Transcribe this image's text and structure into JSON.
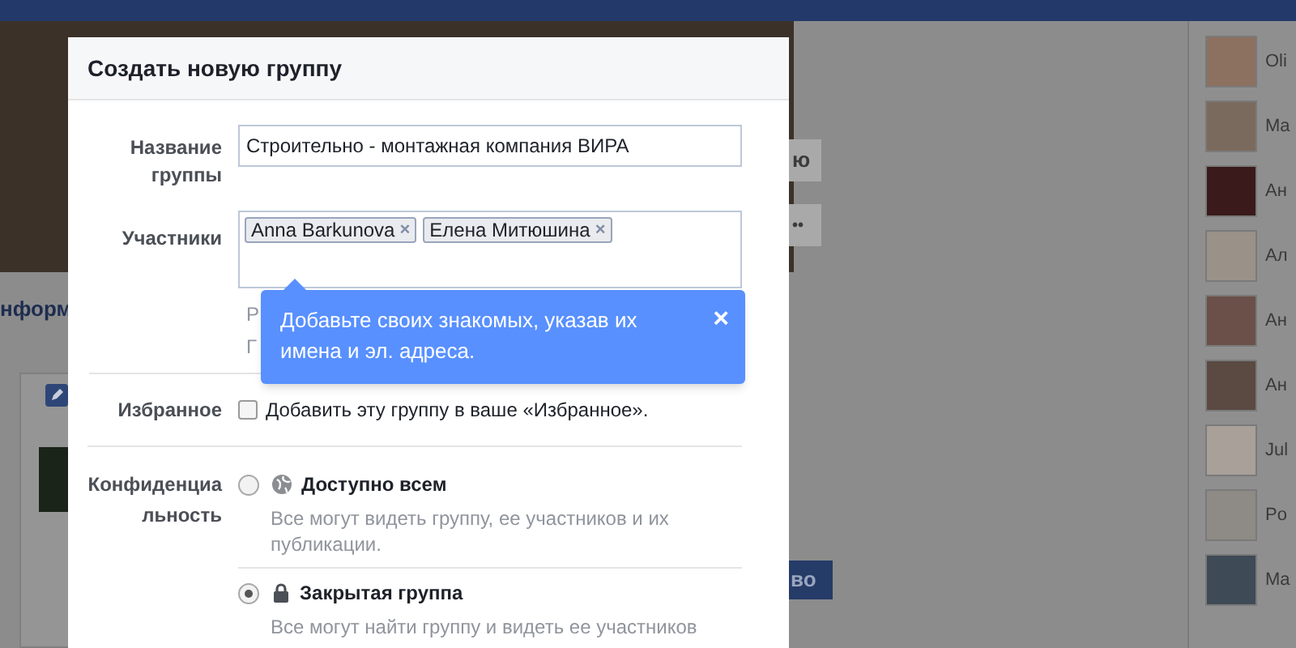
{
  "background": {
    "section_title": "нформ",
    "button_1": "ю",
    "button_2": "••",
    "button_3": "во",
    "friends": [
      {
        "name": "Oli"
      },
      {
        "name": "Ma"
      },
      {
        "name": "Ан"
      },
      {
        "name": "Ал"
      },
      {
        "name": "Ан"
      },
      {
        "name": "Ан"
      },
      {
        "name": "Jul"
      },
      {
        "name": "Po"
      },
      {
        "name": "Ma"
      }
    ]
  },
  "dialog": {
    "title": "Создать новую группу",
    "name_field": {
      "label": "Название группы",
      "value": "Строительно - монтажная компания ВИРА"
    },
    "members_field": {
      "label": "Участники",
      "tokens": [
        {
          "name": "Anna Barkunova",
          "remove": "×"
        },
        {
          "name": "Елена Митюшина",
          "remove": "×"
        }
      ],
      "hint_lines": [
        "Р",
        "Г"
      ]
    },
    "tooltip": {
      "text": "Добавьте своих знакомых, указав их имена и эл. адреса.",
      "close": "×"
    },
    "favorites": {
      "label": "Избранное",
      "text": "Добавить эту группу в ваше «Избранное».",
      "checked": false
    },
    "privacy": {
      "label": "Конфиденциальность",
      "options": [
        {
          "kind": "globe",
          "title": "Доступно всем",
          "description": "Все могут видеть группу, ее участников и их публикации.",
          "selected": false
        },
        {
          "kind": "lock",
          "title": "Закрытая группа",
          "description": "Все могут найти группу и видеть ее участников",
          "selected": true
        }
      ]
    }
  }
}
